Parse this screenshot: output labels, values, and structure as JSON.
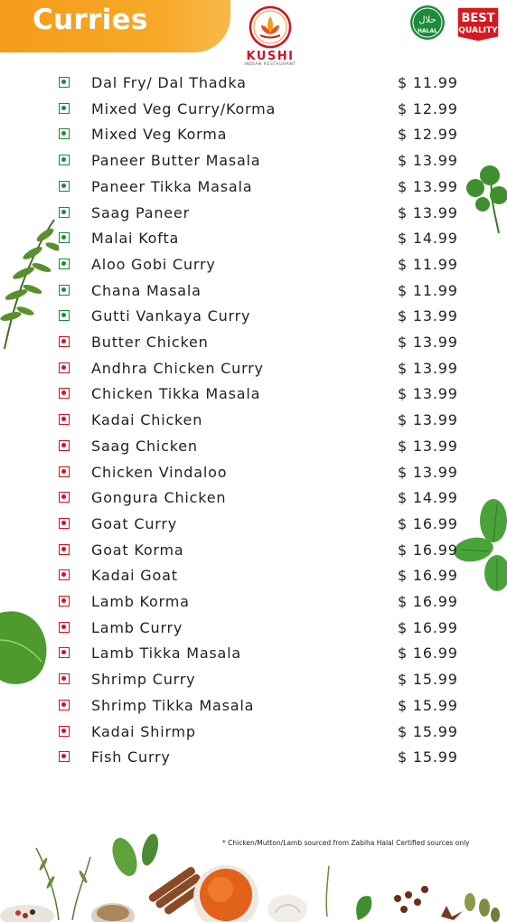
{
  "header": {
    "title": "Curries"
  },
  "logo": {
    "name": "KUSHI",
    "tagline": "INDIAN RESTAURANT"
  },
  "badges": {
    "halal_arabic": "حلال",
    "halal_label": "HALAL",
    "quality_line1": "BEST",
    "quality_line2": "QUALITY"
  },
  "colors": {
    "accent": "#f7a928",
    "veg": "#1c8c35",
    "nonveg": "#d0141f",
    "brand": "#c7162b"
  },
  "menu": {
    "items": [
      {
        "name": "Dal Fry/ Dal Thadka",
        "price": "$ 11.99",
        "type": "veg"
      },
      {
        "name": "Mixed Veg Curry/Korma",
        "price": "$ 12.99",
        "type": "veg"
      },
      {
        "name": "Mixed Veg Korma",
        "price": "$ 12.99",
        "type": "veg"
      },
      {
        "name": "Paneer Butter Masala",
        "price": "$ 13.99",
        "type": "veg"
      },
      {
        "name": "Paneer Tikka Masala",
        "price": "$ 13.99",
        "type": "veg"
      },
      {
        "name": "Saag Paneer",
        "price": "$ 13.99",
        "type": "veg"
      },
      {
        "name": "Malai Kofta",
        "price": "$ 14.99",
        "type": "veg"
      },
      {
        "name": "Aloo Gobi Curry",
        "price": "$ 11.99",
        "type": "veg"
      },
      {
        "name": "Chana Masala",
        "price": "$ 11.99",
        "type": "veg"
      },
      {
        "name": "Gutti Vankaya Curry",
        "price": "$ 13.99",
        "type": "veg"
      },
      {
        "name": "Butter Chicken",
        "price": "$ 13.99",
        "type": "nonveg"
      },
      {
        "name": "Andhra Chicken Curry",
        "price": "$ 13.99",
        "type": "nonveg"
      },
      {
        "name": "Chicken Tikka Masala",
        "price": "$ 13.99",
        "type": "nonveg"
      },
      {
        "name": "Kadai Chicken",
        "price": "$ 13.99",
        "type": "nonveg"
      },
      {
        "name": "Saag Chicken",
        "price": "$ 13.99",
        "type": "nonveg"
      },
      {
        "name": "Chicken Vindaloo",
        "price": "$ 13.99",
        "type": "nonveg"
      },
      {
        "name": "Gongura Chicken",
        "price": "$ 14.99",
        "type": "nonveg"
      },
      {
        "name": "Goat Curry",
        "price": "$ 16.99",
        "type": "nonveg"
      },
      {
        "name": "Goat Korma",
        "price": "$ 16.99",
        "type": "nonveg"
      },
      {
        "name": "Kadai Goat",
        "price": "$ 16.99",
        "type": "nonveg"
      },
      {
        "name": "Lamb Korma",
        "price": "$ 16.99",
        "type": "nonveg"
      },
      {
        "name": "Lamb Curry",
        "price": "$ 16.99",
        "type": "nonveg"
      },
      {
        "name": "Lamb Tikka Masala",
        "price": "$ 16.99",
        "type": "nonveg"
      },
      {
        "name": "Shrimp Curry",
        "price": "$ 15.99",
        "type": "nonveg"
      },
      {
        "name": "Shrimp Tikka Masala",
        "price": "$ 15.99",
        "type": "nonveg"
      },
      {
        "name": "Kadai Shirmp",
        "price": "$ 15.99",
        "type": "nonveg"
      },
      {
        "name": "Fish Curry",
        "price": "$ 15.99",
        "type": "nonveg"
      }
    ]
  },
  "footnote": "* Chicken/Mutton/Lamb sourced from Zabiha Halal Certified sources only"
}
